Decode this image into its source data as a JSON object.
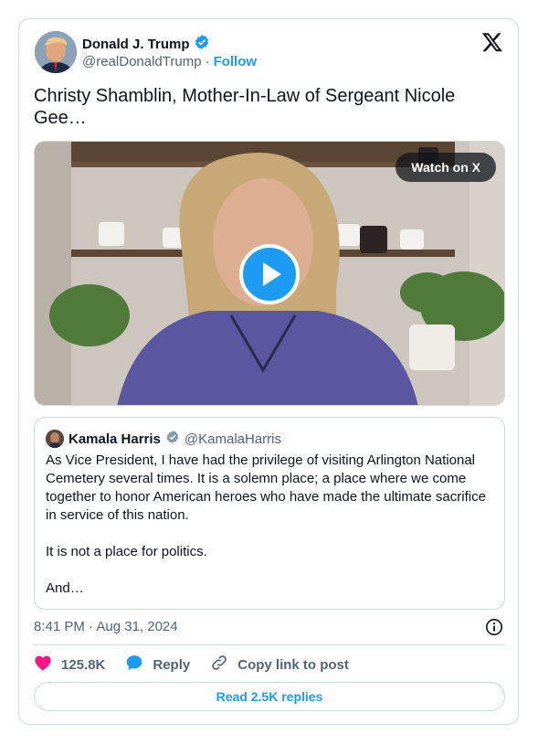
{
  "author": {
    "name": "Donald J. Trump",
    "handle": "@realDonaldTrump",
    "follow_label": "Follow",
    "separator": "·"
  },
  "tweet": {
    "text": "Christy Shamblin, Mother-In-Law of Sergeant Nicole Gee…"
  },
  "media": {
    "watch_label": "Watch on X"
  },
  "quoted": {
    "name": "Kamala Harris",
    "handle": "@KamalaHarris",
    "paragraphs": [
      "As Vice President, I have had the privilege of visiting Arlington National Cemetery several times. It is a solemn place; a place where we come together to honor American heroes who have made the ultimate sacrifice in service of this nation.",
      "It is not a place for politics.",
      "And…"
    ]
  },
  "meta": {
    "timestamp": "8:41 PM · Aug 31, 2024"
  },
  "actions": {
    "likes": "125.8K",
    "reply_label": "Reply",
    "copy_label": "Copy link to post"
  },
  "read_replies_label": "Read 2.5K replies",
  "colors": {
    "accent": "#1d9bf0",
    "like": "#f91880",
    "muted": "#536471",
    "border": "#cfd9de"
  }
}
